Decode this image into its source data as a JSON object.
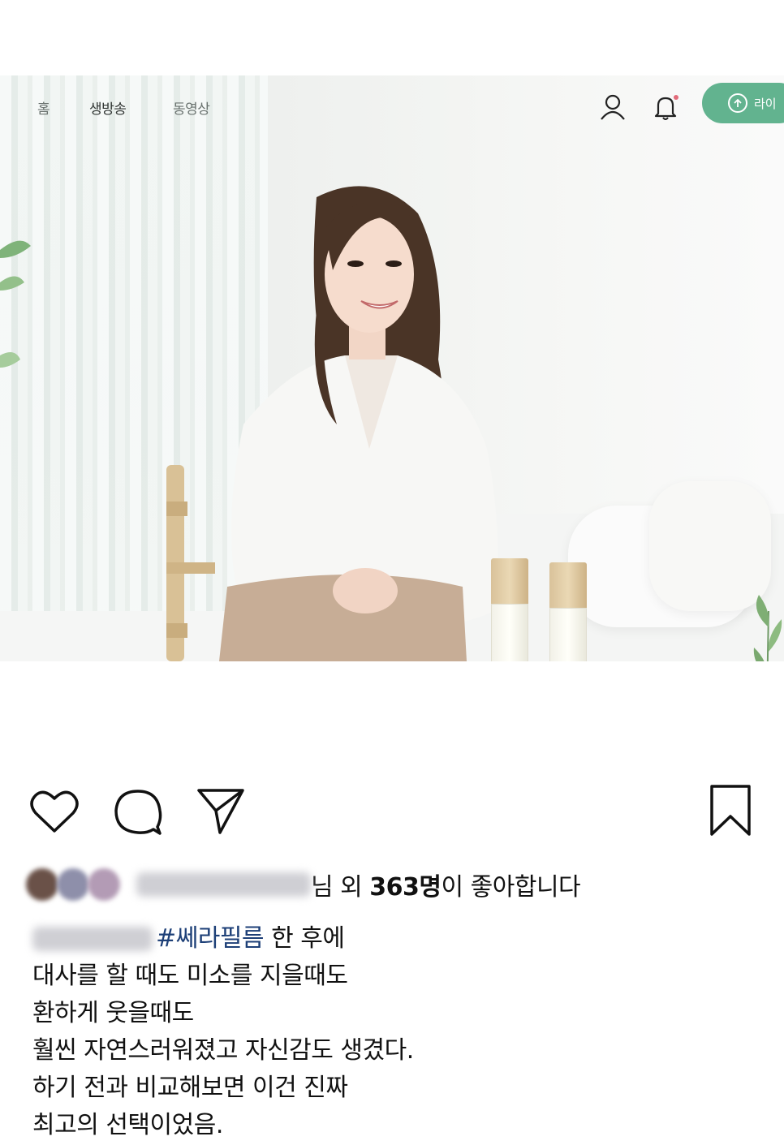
{
  "nav": {
    "items": [
      "홈",
      "생방송",
      "동영상"
    ],
    "active_index": 1,
    "live_button_label": "라이"
  },
  "post": {
    "likes": {
      "prefix_suffix": "님 외 ",
      "count": "363명",
      "tail": "이 좋아합니다"
    },
    "caption": {
      "hashtag": "#쎄라필름",
      "first_line_rest": " 한 후에",
      "lines": [
        "대사를 할 때도 미소를 지을때도",
        "환하게 웃을때도",
        "훨씬 자연스러워졌고 자신감도 생겼다.",
        "하기 전과 비교해보면 이건 진짜",
        "최고의 선택이었음."
      ]
    }
  },
  "icons": {
    "user": "user-icon",
    "bell": "bell-icon",
    "upload": "upload-circle-icon",
    "heart": "heart-icon",
    "comment": "comment-icon",
    "share": "share-icon",
    "bookmark": "bookmark-icon"
  },
  "colors": {
    "live_button": "#62b38f",
    "hashtag": "#1d3f77",
    "notification_dot": "#e26b7a"
  }
}
